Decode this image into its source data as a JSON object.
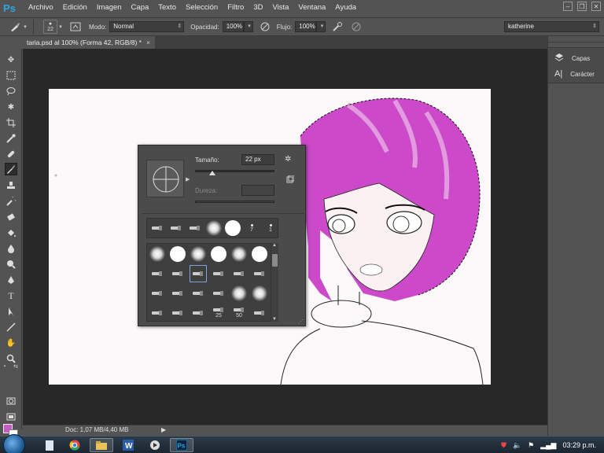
{
  "app": {
    "logo": "Ps"
  },
  "menu": [
    "Archivo",
    "Edición",
    "Imagen",
    "Capa",
    "Texto",
    "Selección",
    "Filtro",
    "3D",
    "Vista",
    "Ventana",
    "Ayuda"
  ],
  "window_controls": [
    "minimize",
    "restore",
    "close"
  ],
  "options": {
    "brush_size": "22",
    "mode_label": "Modo:",
    "mode_value": "Normal",
    "opacity_label": "Opacidad:",
    "opacity_value": "100%",
    "flow_label": "Flujo:",
    "flow_value": "100%",
    "workspace": "katherine"
  },
  "document": {
    "tab_title": "taria.psd al 100% (Forma 42, RGB/8) *",
    "close_glyph": "×"
  },
  "brush_picker": {
    "size_label": "Tamaño:",
    "size_value": "22 px",
    "hardness_label": "Dureza:",
    "hardness_value": "",
    "size_fraction": 0.22,
    "recent_brushes": [
      {
        "kind": "tip",
        "label": ""
      },
      {
        "kind": "tip",
        "label": ""
      },
      {
        "kind": "tip",
        "label": ""
      },
      {
        "kind": "soft",
        "label": ""
      },
      {
        "kind": "hard",
        "label": ""
      },
      {
        "kind": "dot",
        "label": "7"
      },
      {
        "kind": "dot",
        "label": "1"
      }
    ],
    "brush_rows": [
      [
        {
          "kind": "soft",
          "label": ""
        },
        {
          "kind": "hard",
          "label": ""
        },
        {
          "kind": "soft",
          "label": ""
        },
        {
          "kind": "hard",
          "label": ""
        },
        {
          "kind": "soft",
          "label": ""
        },
        {
          "kind": "hard",
          "label": ""
        }
      ],
      [
        {
          "kind": "tip",
          "label": ""
        },
        {
          "kind": "tip",
          "label": ""
        },
        {
          "kind": "tip",
          "label": "",
          "selected": true
        },
        {
          "kind": "tip",
          "label": ""
        },
        {
          "kind": "tip",
          "label": ""
        },
        {
          "kind": "tip",
          "label": ""
        }
      ],
      [
        {
          "kind": "tip",
          "label": ""
        },
        {
          "kind": "tip",
          "label": ""
        },
        {
          "kind": "tip",
          "label": ""
        },
        {
          "kind": "tip",
          "label": ""
        },
        {
          "kind": "soft",
          "label": ""
        },
        {
          "kind": "soft",
          "label": ""
        }
      ],
      [
        {
          "kind": "tip",
          "label": ""
        },
        {
          "kind": "tip",
          "label": ""
        },
        {
          "kind": "tip",
          "label": ""
        },
        {
          "kind": "tip",
          "label": "25"
        },
        {
          "kind": "tip",
          "label": "50"
        },
        {
          "kind": "tip",
          "label": ""
        }
      ]
    ]
  },
  "panels": [
    {
      "icon": "layers-icon",
      "label": "Capas"
    },
    {
      "icon": "character-icon",
      "label": "Carácter"
    }
  ],
  "status": {
    "doc_info": "Doc: 1,07 MB/4,40 MB"
  },
  "colors": {
    "foreground": "#c95ac3",
    "background": "#ffffff"
  },
  "taskbar": {
    "clock": "03:29 p.m."
  }
}
